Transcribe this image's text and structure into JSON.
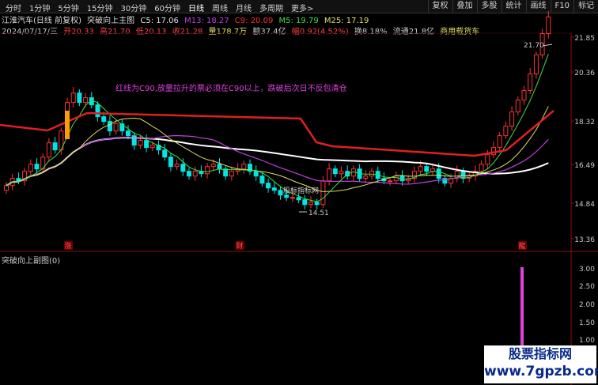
{
  "toolbar": {
    "periods": [
      "分时",
      "1分钟",
      "5分钟",
      "15分钟",
      "30分钟",
      "60分钟",
      "日线",
      "周线",
      "月线",
      "多周期",
      "更多>"
    ],
    "right_buttons": [
      "复权",
      "叠加",
      "多股",
      "统计",
      "画线",
      "F10",
      "标记"
    ]
  },
  "header": {
    "stock": "江淮汽车(日线 前复权)",
    "indicator": "突破向上主图",
    "c5": "C5: 17.06",
    "m13": "M13: 18.27",
    "c9": "C9: 20.09",
    "m5": "M5: 19.79",
    "m25": "M25: 17.19",
    "date": "2024/07/17/三",
    "open": "开20.33",
    "high": "高21.70",
    "low": "低20.13",
    "close": "收21.28",
    "volume": "量178.7万",
    "amount": "额37.4亿",
    "change": "幅0.92(4.52%)",
    "turnover": "换8.18%",
    "float": "流通21.8亿",
    "sector": "商用载货车"
  },
  "note": "红线为C90,放量拉升的票必须在C90以上，跌破后次日不反包清仓",
  "main_axis": [
    "21.85",
    "20.36",
    "18.32",
    "16.49",
    "14.84",
    "13.36"
  ],
  "annotations": {
    "high": "21.70",
    "low": "14.51",
    "legend": "股标指标网"
  },
  "markers": [
    "涨",
    "财",
    "龍"
  ],
  "sub": {
    "title": "突破向上副图(0)",
    "axis": [
      "3.00",
      "2.50",
      "2.00",
      "1.50",
      "1.00"
    ]
  },
  "watermark": {
    "line1": "股票指标网",
    "line2": "www.7gpzb.com"
  },
  "colors": {
    "up": "#ff3232",
    "down": "#00e5e5",
    "c90": "#e02020",
    "white": "#ffffff",
    "magenta": "#c040e0",
    "yellow": "#e0e060"
  }
}
